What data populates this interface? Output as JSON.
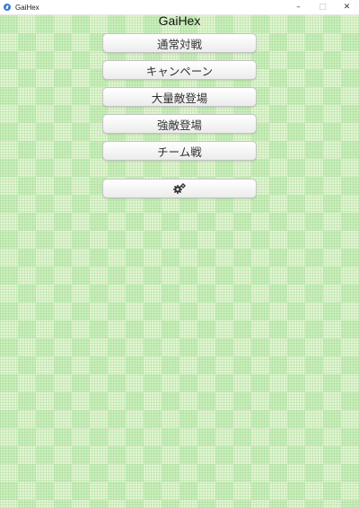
{
  "window": {
    "title": "GaiHex",
    "minimize_glyph": "–",
    "maximize_glyph": "□",
    "close_glyph": "✕"
  },
  "app": {
    "title": "GaiHex"
  },
  "menu": {
    "items": [
      {
        "label": "通常対戦"
      },
      {
        "label": "キャンペーン"
      },
      {
        "label": "大量敵登場"
      },
      {
        "label": "強敵登場"
      },
      {
        "label": "チーム戦"
      }
    ],
    "settings_icon": "gears-icon"
  },
  "colors": {
    "background_light": "#e4f5d2",
    "background_dark": "#cdeebc",
    "button_face": "#f5f5f5"
  }
}
